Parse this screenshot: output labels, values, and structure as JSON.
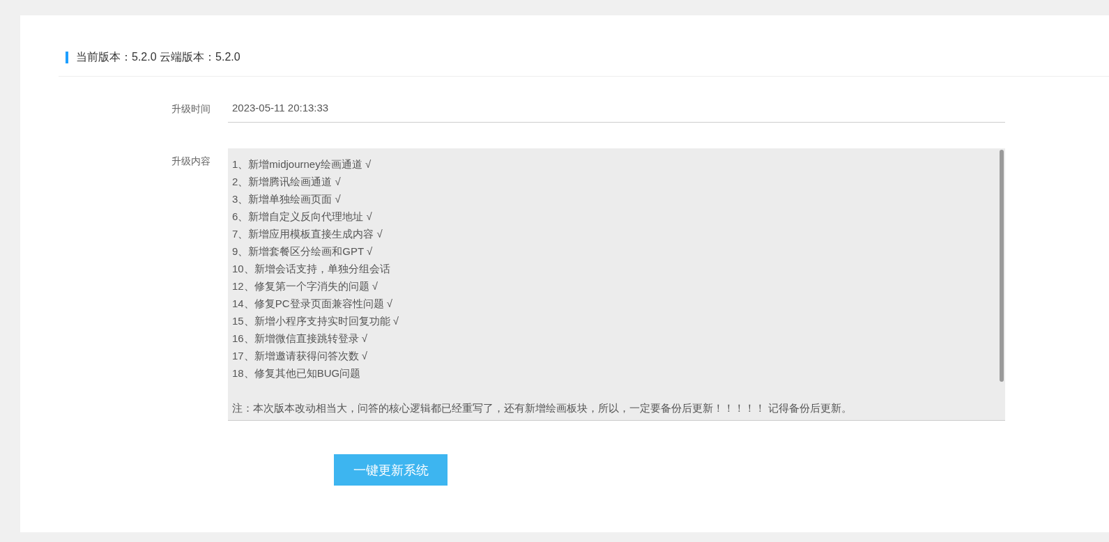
{
  "header": {
    "title": "当前版本：5.2.0 云端版本：5.2.0"
  },
  "upgrade_time": {
    "label": "升级时间",
    "value": "2023-05-11 20:13:33"
  },
  "upgrade_content": {
    "label": "升级内容",
    "lines": [
      "1、新增midjourney绘画通道 √",
      "2、新增腾讯绘画通道 √",
      "3、新增单独绘画页面 √",
      "6、新增自定义反向代理地址  √",
      "7、新增应用模板直接生成内容 √",
      "9、新增套餐区分绘画和GPT √",
      "10、新增会话支持，单独分组会话",
      "12、修复第一个字消失的问题  √",
      "14、修复PC登录页面兼容性问题  √",
      "15、新增小程序支持实时回复功能  √",
      "16、新增微信直接跳转登录  √",
      "17、新增邀请获得问答次数 √",
      "18、修复其他已知BUG问题"
    ],
    "note": "注：本次版本改动相当大，问答的核心逻辑都已经重写了，还有新增绘画板块，所以，一定要备份后更新！！！！！ 记得备份后更新。"
  },
  "button": "一键更新系统"
}
